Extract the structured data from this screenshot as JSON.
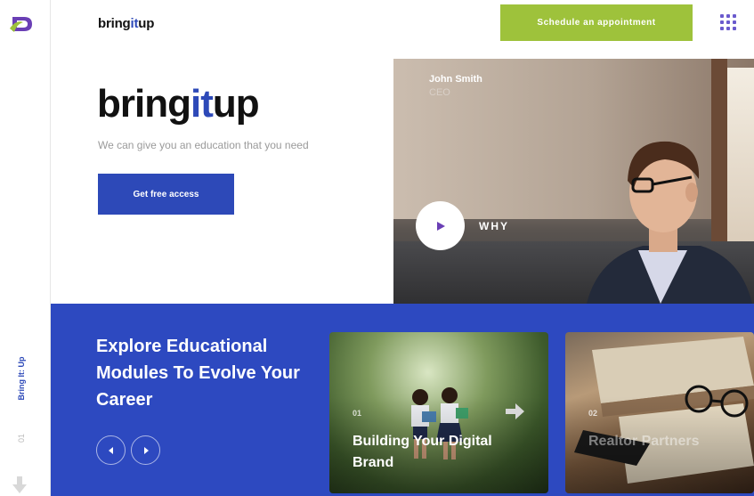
{
  "rail": {
    "vertical_title": "Bring It: Up",
    "slide_number": "01"
  },
  "header": {
    "brand": {
      "prefix": "bring",
      "accent": "it",
      "suffix": "up"
    },
    "cta_label": "Schedule an appointment"
  },
  "hero": {
    "brand": {
      "prefix": "bring",
      "accent": "it",
      "suffix": "up"
    },
    "subtitle": "We can give you an education that you need",
    "button_label": "Get free access",
    "video": {
      "name": "John Smith",
      "role": "CEO",
      "caption": "WHY"
    }
  },
  "modules": {
    "title": "Explore Educational Modules To Evolve Your Career",
    "cards": [
      {
        "number": "01",
        "title": "Building Your Digital Brand"
      },
      {
        "number": "02",
        "title": "Realtor Partners"
      }
    ]
  },
  "colors": {
    "primary": "#2d49b8",
    "accent_green": "#9ec23b",
    "menu_purple": "#6a5acd"
  }
}
